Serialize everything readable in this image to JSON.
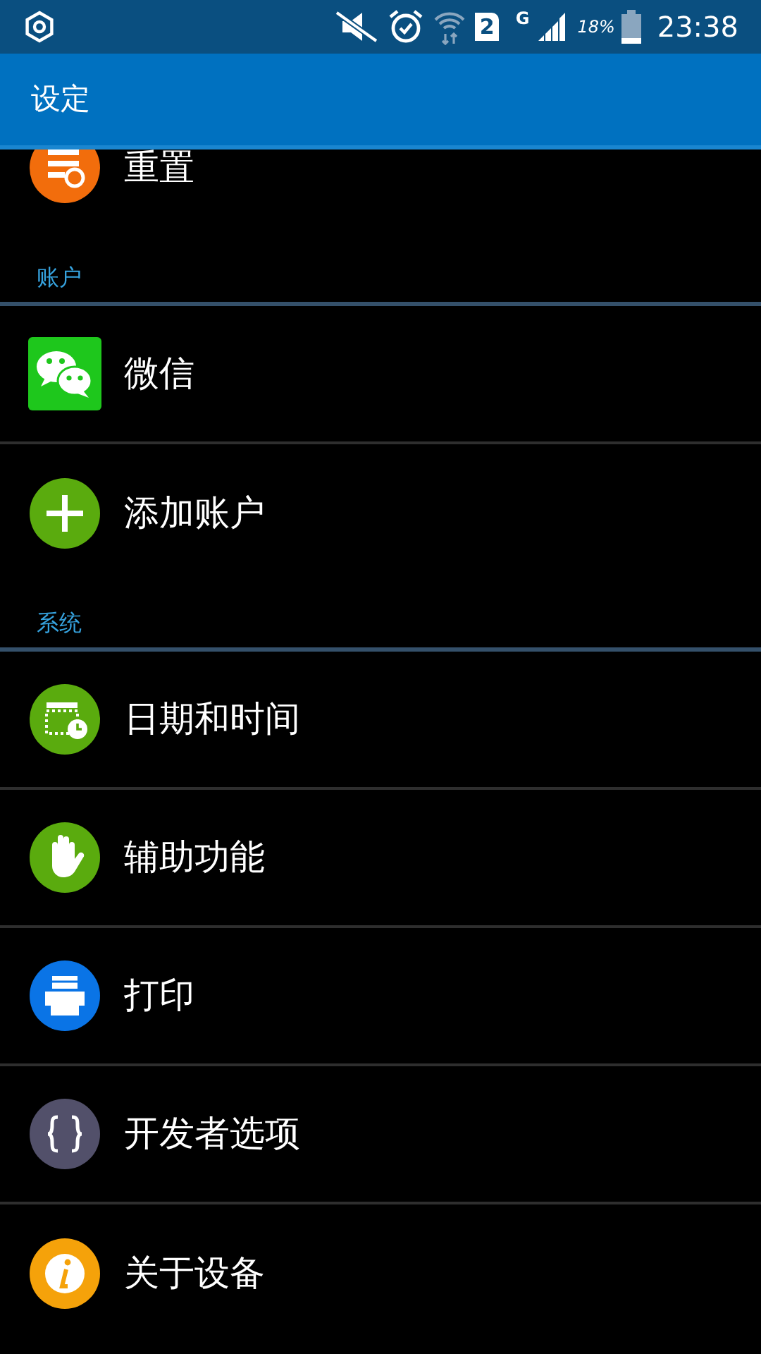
{
  "status_bar": {
    "sim_slot": "2",
    "network": "G",
    "battery": "18%",
    "time": "23:38"
  },
  "app_bar": {
    "title": "设定"
  },
  "list": [
    {
      "kind": "reset",
      "label": "重置"
    },
    {
      "kind": "header",
      "label": "账户"
    },
    {
      "kind": "wechat",
      "label": "微信"
    },
    {
      "kind": "add",
      "label": "添加账户"
    },
    {
      "kind": "header",
      "label": "系统"
    },
    {
      "kind": "datetime",
      "label": "日期和时间"
    },
    {
      "kind": "accessibility",
      "label": "辅助功能"
    },
    {
      "kind": "print",
      "label": "打印"
    },
    {
      "kind": "developer",
      "label": "开发者选项"
    },
    {
      "kind": "about",
      "label": "关于设备"
    }
  ]
}
